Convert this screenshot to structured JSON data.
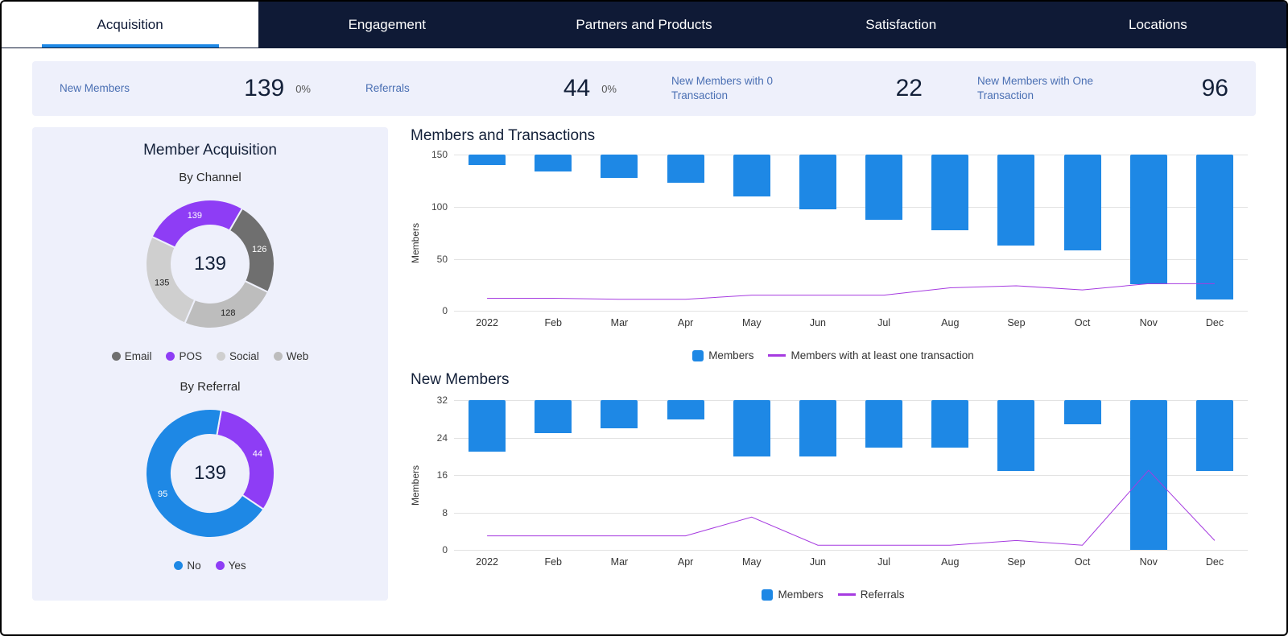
{
  "tabs": [
    "Acquisition",
    "Engagement",
    "Partners and Products",
    "Satisfaction",
    "Locations"
  ],
  "activeTab": 0,
  "kpis": [
    {
      "label": "New Members",
      "value": "139",
      "pct": "0%"
    },
    {
      "label": "Referrals",
      "value": "44",
      "pct": "0%"
    },
    {
      "label": "New Members with 0 Transaction",
      "value": "22",
      "pct": ""
    },
    {
      "label": "New Members with One Transaction",
      "value": "96",
      "pct": ""
    }
  ],
  "leftPanel": {
    "title": "Member Acquisition",
    "byChannel": {
      "title": "By Channel",
      "center": "139",
      "legend": [
        "Email",
        "POS",
        "Social",
        "Web"
      ]
    },
    "byReferral": {
      "title": "By Referral",
      "center": "139",
      "legend": [
        "No",
        "Yes"
      ]
    }
  },
  "membersTransactions": {
    "title": "Members and Transactions",
    "yAxisLabel": "Members",
    "legend": {
      "bars": "Members",
      "line": "Members with at least one transaction"
    }
  },
  "newMembers": {
    "title": "New Members",
    "yAxisLabel": "Members",
    "legend": {
      "bars": "Members",
      "line": "Referrals"
    }
  },
  "colors": {
    "blue": "#1e88e5",
    "purple": "#8e3df5",
    "purpleLine": "#a63be0",
    "grayDark": "#6f6f6f",
    "grayLight": "#bdbdbd"
  },
  "chart_data": [
    {
      "type": "donut",
      "title": "Member Acquisition — By Channel",
      "total": 139,
      "slices": [
        {
          "name": "Email",
          "value": 126,
          "color": "#6f6f6f"
        },
        {
          "name": "Web",
          "value": 128,
          "color": "#bdbdbd"
        },
        {
          "name": "Social",
          "value": 135,
          "color": "#cfcfcf"
        },
        {
          "name": "POS",
          "value": 139,
          "color": "#8e3df5"
        }
      ]
    },
    {
      "type": "donut",
      "title": "Member Acquisition — By Referral",
      "total": 139,
      "slices": [
        {
          "name": "No",
          "value": 95,
          "color": "#1e88e5"
        },
        {
          "name": "Yes",
          "value": 44,
          "color": "#8e3df5"
        }
      ]
    },
    {
      "type": "bar+line",
      "title": "Members and Transactions",
      "xlabel": "",
      "ylabel": "Members",
      "ylim": [
        0,
        150
      ],
      "yticks": [
        0,
        50,
        100,
        150
      ],
      "categories": [
        "2022",
        "Feb",
        "Mar",
        "Apr",
        "May",
        "Jun",
        "Jul",
        "Aug",
        "Sep",
        "Oct",
        "Nov",
        "Dec"
      ],
      "series": [
        {
          "name": "Members",
          "kind": "bar",
          "color": "#1e88e5",
          "values": [
            10,
            16,
            22,
            27,
            40,
            52,
            62,
            72,
            87,
            92,
            124,
            139
          ]
        },
        {
          "name": "Members with at least one transaction",
          "kind": "line",
          "color": "#a63be0",
          "values": [
            12,
            12,
            11,
            11,
            15,
            15,
            15,
            22,
            24,
            20,
            26,
            26
          ]
        }
      ]
    },
    {
      "type": "bar+line",
      "title": "New Members",
      "xlabel": "",
      "ylabel": "Members",
      "ylim": [
        0,
        32
      ],
      "yticks": [
        0,
        8,
        16,
        24,
        32
      ],
      "categories": [
        "2022",
        "Feb",
        "Mar",
        "Apr",
        "May",
        "Jun",
        "Jul",
        "Aug",
        "Sep",
        "Oct",
        "Nov",
        "Dec"
      ],
      "series": [
        {
          "name": "Members",
          "kind": "bar",
          "color": "#1e88e5",
          "values": [
            11,
            7,
            6,
            4,
            12,
            12,
            10,
            10,
            15,
            5,
            32,
            15
          ]
        },
        {
          "name": "Referrals",
          "kind": "line",
          "color": "#a63be0",
          "values": [
            3,
            3,
            3,
            3,
            7,
            1,
            1,
            1,
            2,
            1,
            17,
            2
          ]
        }
      ]
    }
  ]
}
